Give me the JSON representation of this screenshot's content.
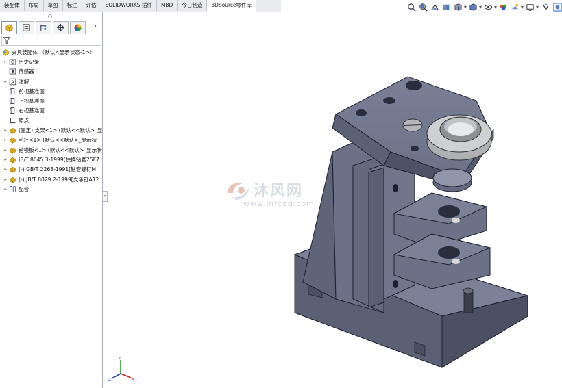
{
  "tabs": [
    {
      "label": "装配体"
    },
    {
      "label": "布局"
    },
    {
      "label": "草图"
    },
    {
      "label": "标注"
    },
    {
      "label": "评估"
    },
    {
      "label": "SOLIDWORKS 插件"
    },
    {
      "label": "MBD"
    },
    {
      "label": "今日制造"
    },
    {
      "label": "3DSource零件库",
      "active": true
    }
  ],
  "heads_up_toolbar": [
    "zoom-to-fit-icon",
    "zoom-area-icon",
    "previous-view-icon",
    "section-view-icon",
    "view-orientation-icon",
    "display-style-icon",
    "hide-show-icon",
    "edit-appearance-icon",
    "apply-scene-icon",
    "view-settings-icon",
    "display-pane-icon"
  ],
  "panel_tabs": [
    "feature-manager-icon",
    "property-manager-icon",
    "configuration-manager-icon",
    "dimxpert-icon",
    "display-manager-icon"
  ],
  "tree": {
    "root": "夹具装配体 （默认<显示状态-1>）",
    "items": [
      {
        "label": "历史记录",
        "icon": "history-folder-icon",
        "expandable": true
      },
      {
        "label": "传感器",
        "icon": "sensor-icon",
        "expandable": false
      },
      {
        "label": "注解",
        "icon": "annotation-icon",
        "expandable": true
      },
      {
        "label": "前视基准面",
        "icon": "plane-icon",
        "expandable": false
      },
      {
        "label": "上视基准面",
        "icon": "plane-icon",
        "expandable": false
      },
      {
        "label": "右视基准面",
        "icon": "plane-icon",
        "expandable": false
      },
      {
        "label": "原点",
        "icon": "origin-icon",
        "expandable": false
      },
      {
        "label": "(固定) 支架<1> (默认<<默认>_显",
        "icon": "part-icon",
        "expandable": true
      },
      {
        "label": "毛坯<1> (默认<<默认>_显示状",
        "icon": "part-icon",
        "expandable": true
      },
      {
        "label": "钻模板<1> (默认<<默认>_显示状",
        "icon": "part-icon",
        "expandable": true
      },
      {
        "label": "JB/T 8045.3-1999[快换钻套25F7",
        "icon": "part-icon",
        "expandable": true
      },
      {
        "label": "(-) GB/T 2268-1991[钻套螺钉M",
        "icon": "part-icon",
        "expandable": true
      },
      {
        "label": "(-) JB/T 8029.2-1999[支承钉A12",
        "icon": "part-icon",
        "expandable": true
      },
      {
        "label": "配合",
        "icon": "mates-icon",
        "expandable": true
      }
    ]
  },
  "watermark": {
    "brand": "沐风网",
    "url": "www.mfcad.com"
  },
  "triad": {
    "axes": [
      "X",
      "Y",
      "Z"
    ],
    "colors": {
      "x": "#d22020",
      "y": "#2a9a2a",
      "z": "#1f3fd1"
    }
  },
  "colors": {
    "part": "#6b7186",
    "part_light": "#858aa0",
    "part_dark": "#4e5366",
    "bushing": "#c9c9c9",
    "accent": "#2a73c8"
  }
}
